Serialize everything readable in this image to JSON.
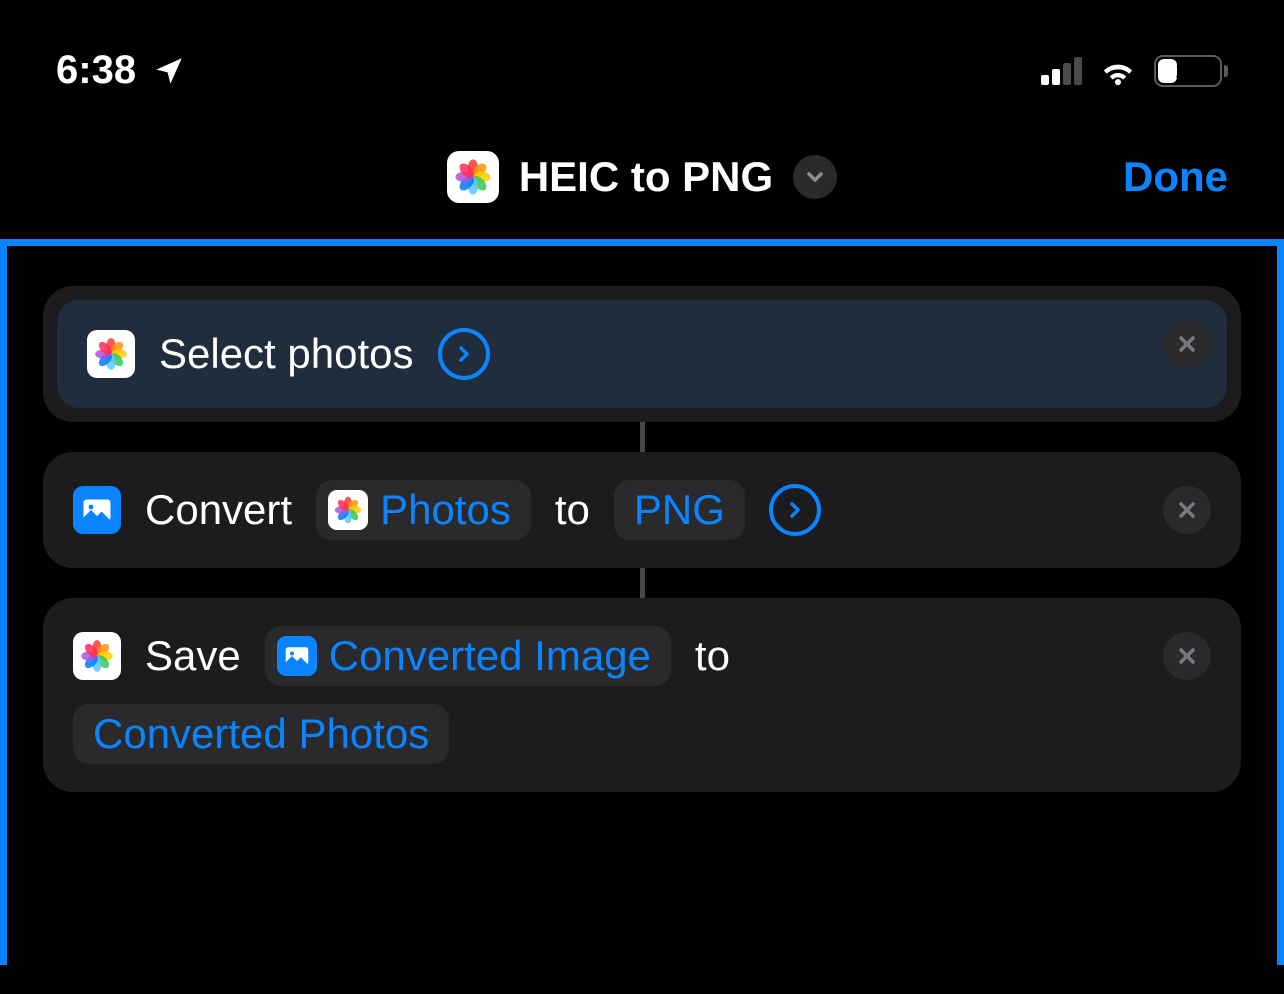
{
  "status_bar": {
    "time": "6:38",
    "battery_percent": "22",
    "battery_level": 22
  },
  "nav": {
    "title": "HEIC to PNG",
    "done_label": "Done"
  },
  "actions": {
    "select": {
      "label": "Select photos"
    },
    "convert": {
      "prefix": "Convert",
      "input": "Photos",
      "mid": "to",
      "format": "PNG"
    },
    "save": {
      "prefix": "Save",
      "input": "Converted Image",
      "mid": "to",
      "destination": "Converted Photos"
    }
  }
}
